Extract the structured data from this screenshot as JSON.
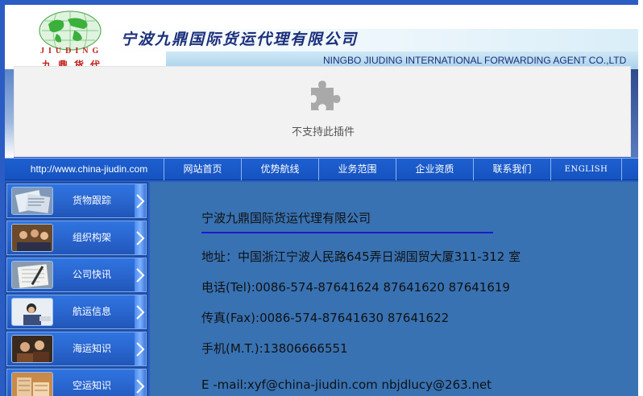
{
  "header": {
    "logo_text": "JIUDING",
    "logo_cn": "九鼎货代",
    "company_cn": "宁波九鼎国际货运代理有限公司",
    "company_en": "NINGBO JIUDING INTERNATIONAL FORWARDING AGENT CO.,LTD"
  },
  "plugin": {
    "message": "不支持此插件"
  },
  "nav": {
    "url": "http://www.china-jiudin.com",
    "items": [
      {
        "label": "网站首页"
      },
      {
        "label": "优势航线"
      },
      {
        "label": "业务范围"
      },
      {
        "label": "企业资质"
      },
      {
        "label": "联系我们"
      },
      {
        "label": "ENGLISH"
      }
    ]
  },
  "sidebar": {
    "items": [
      {
        "label": "货物跟踪",
        "icon": "documents-photo-icon"
      },
      {
        "label": "组织构架",
        "icon": "team-meeting-photo-icon"
      },
      {
        "label": "公司快讯",
        "icon": "notebook-photo-icon"
      },
      {
        "label": "航运信息",
        "icon": "phone-worker-photo-icon"
      },
      {
        "label": "海运知识",
        "icon": "office-people-photo-icon"
      },
      {
        "label": "空运知识",
        "icon": "building-photo-icon"
      }
    ]
  },
  "content": {
    "title": "宁波九鼎国际货运代理有限公司",
    "address": "地址：中国浙江宁波人民路645弄日湖国贸大厦311-312 室",
    "tel": "电话(Tel):0086-574-87641624 87641620 87641619",
    "fax": "传真(Fax):0086-574-87641630 87641622",
    "mobile": "手机(M.T.):13806666551",
    "email": " E -mail:xyf@china-jiudin.com nbjdlucy@263.net"
  },
  "colors": {
    "frame_blue": "#2a5cc4",
    "content_bg": "#3872b3",
    "navbar": "#1e5fd0",
    "title_navy": "#1a2f7a",
    "logo_red": "#c0201a"
  }
}
